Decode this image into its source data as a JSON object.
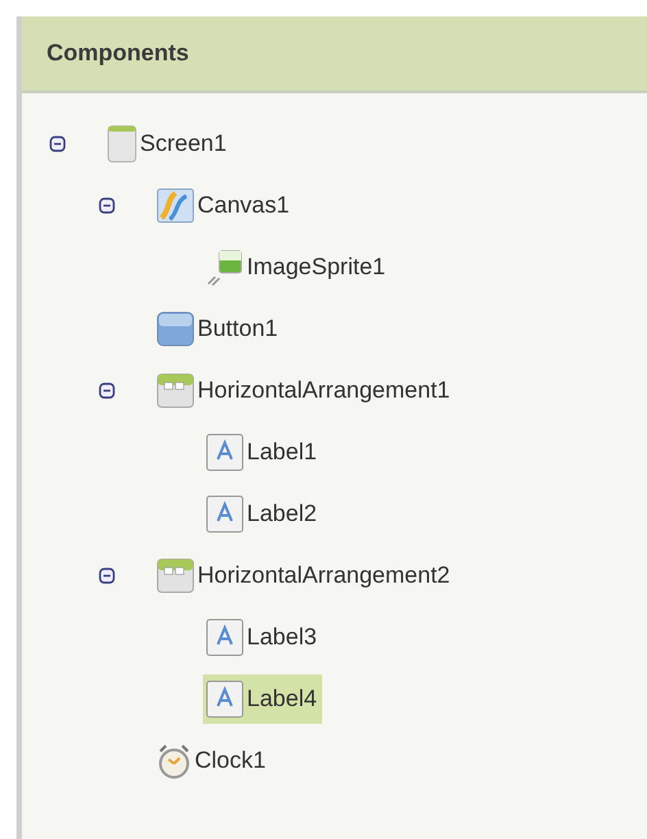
{
  "panel": {
    "title": "Components"
  },
  "tree": [
    {
      "kind": "screen",
      "name": "Screen1",
      "selected": false,
      "expanded": true,
      "children": [
        {
          "kind": "canvas",
          "name": "Canvas1",
          "selected": false,
          "expanded": true,
          "children": [
            {
              "kind": "sprite",
              "name": "ImageSprite1",
              "selected": false
            }
          ]
        },
        {
          "kind": "button",
          "name": "Button1",
          "selected": false
        },
        {
          "kind": "arrangement",
          "name": "HorizontalArrangement1",
          "selected": false,
          "expanded": true,
          "children": [
            {
              "kind": "label",
              "name": "Label1",
              "selected": false
            },
            {
              "kind": "label",
              "name": "Label2",
              "selected": false
            }
          ]
        },
        {
          "kind": "arrangement",
          "name": "HorizontalArrangement2",
          "selected": false,
          "expanded": true,
          "children": [
            {
              "kind": "label",
              "name": "Label3",
              "selected": false
            },
            {
              "kind": "label",
              "name": "Label4",
              "selected": true
            }
          ]
        },
        {
          "kind": "clock",
          "name": "Clock1",
          "selected": false
        }
      ]
    }
  ]
}
